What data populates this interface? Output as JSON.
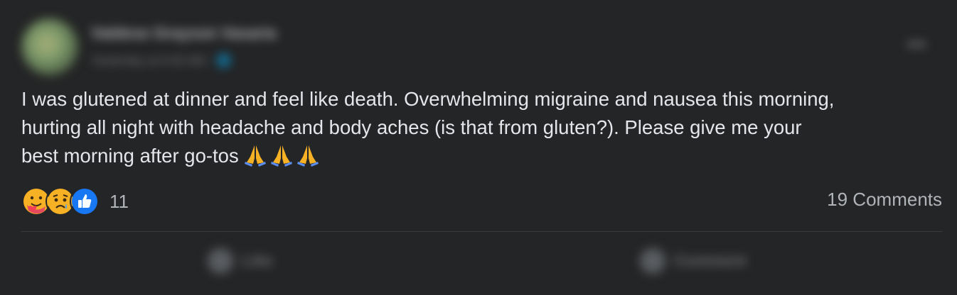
{
  "post": {
    "author_name": "Valdese Grayson Vasaria",
    "meta": "Yesterday at 9:30 AM · 🌐",
    "more_icon": "more-options-icon",
    "text": "I was glutened at dinner and feel like death. Overwhelming migraine and nausea this morning,\nhurting all night with headache and body aches (is that from gluten?). Please give me your\nbest morning after go-tos",
    "emoji_icon": "folded-hands-emoji",
    "emoji_count": 3
  },
  "reactions": {
    "icons": [
      "care-reaction-icon",
      "sad-reaction-icon",
      "like-reaction-icon"
    ],
    "count": "11"
  },
  "comments": {
    "count_label": "19 Comments"
  },
  "actions": {
    "like_label": "Like",
    "comment_label": "Comment"
  },
  "colors": {
    "background": "#242526",
    "text": "#e4e6eb",
    "secondary_text": "#b0b3b8",
    "like_blue": "#1877f2",
    "reaction_yellow": "#f7b125",
    "divider": "#3a3b3c"
  }
}
